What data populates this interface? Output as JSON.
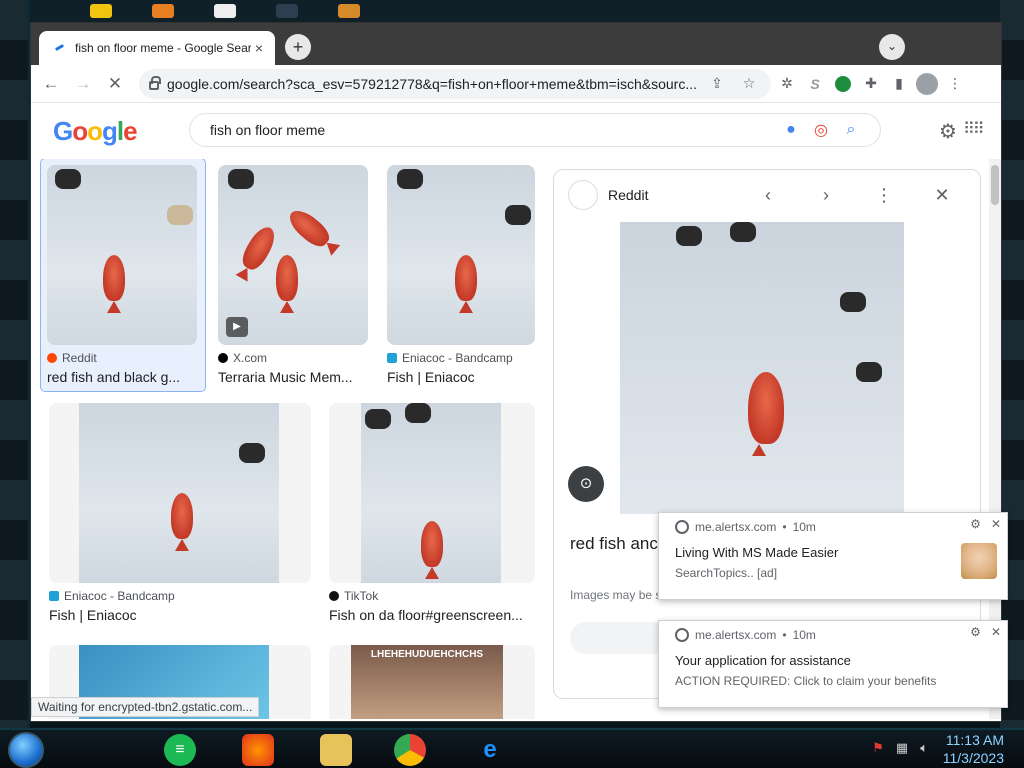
{
  "browser": {
    "tab_title": "fish on floor meme - Google Search",
    "tab_close": "×",
    "new_tab": "+",
    "url": "google.com/search?sca_esv=579212778&q=fish+on+floor+meme&tbm=isch&sourc...",
    "status_text": "Waiting for encrypted-tbn2.gstatic.com..."
  },
  "google": {
    "logo_letters": [
      "G",
      "o",
      "o",
      "g",
      "l",
      "e"
    ],
    "query": "fish on floor meme"
  },
  "results": [
    {
      "source": "Reddit",
      "caption": "red fish and black g...",
      "source_color": "#ff4500"
    },
    {
      "source": "X.com",
      "caption": "Terraria Music Mem...",
      "source_color": "#000000"
    },
    {
      "source": "Eniacoc - Bandcamp",
      "caption": "Fish | Eniacoc",
      "source_color": "#21a2d6"
    },
    {
      "source": "Eniacoc - Bandcamp",
      "caption": "Fish | Eniacoc",
      "source_color": "#21a2d6"
    },
    {
      "source": "TikTok",
      "caption": "Fish on da floor#greenscreen...",
      "source_color": "#111111"
    }
  ],
  "bottom_thumbs": [
    {
      "caption": ""
    },
    {
      "caption": "LHEHEHUDUEHCHCHS"
    }
  ],
  "preview": {
    "source": "Reddit",
    "title": "red fish anc ukulele anc",
    "note": "Images may be s"
  },
  "notifications": [
    {
      "site": "me.alertsx.com",
      "age": "10m",
      "title": "Living With MS Made Easier",
      "body": "SearchTopics.. [ad]"
    },
    {
      "site": "me.alertsx.com",
      "age": "10m",
      "title": "Your application for assistance",
      "body": "ACTION REQUIRED: Click to claim your benefits"
    }
  ],
  "clock": {
    "time": "11:13 AM",
    "date": "11/3/2023"
  },
  "colors": {
    "accent": "#1a73e8",
    "tab_bg": "#3c3c3c"
  }
}
